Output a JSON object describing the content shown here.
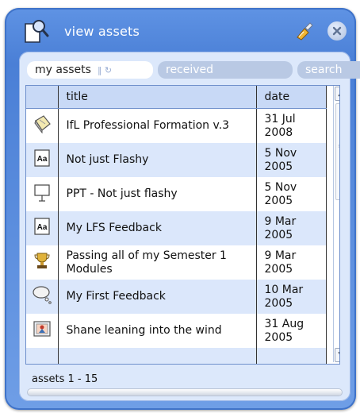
{
  "window": {
    "title": "view assets",
    "icons": {
      "app": "search-document-icon",
      "tool": "brush-icon",
      "close": "close-icon"
    }
  },
  "tabs": [
    {
      "label": "my assets",
      "active": true
    },
    {
      "label": "received",
      "active": false
    },
    {
      "label": "search",
      "active": false
    }
  ],
  "table": {
    "headers": {
      "icon": "",
      "title": "title",
      "date": "date"
    },
    "rows": [
      {
        "icon": "notebook-icon",
        "title": "IfL Professional Formation v.3",
        "date": "31 Jul 2008"
      },
      {
        "icon": "text-document-icon",
        "title": "Not just Flashy",
        "date": "5 Nov 2005"
      },
      {
        "icon": "presentation-icon",
        "title": "PPT - Not just flashy",
        "date": "5 Nov 2005"
      },
      {
        "icon": "text-document-icon",
        "title": "My LFS Feedback",
        "date": "9 Mar 2005"
      },
      {
        "icon": "trophy-icon",
        "title": "Passing all of my Semester 1 Modules",
        "date": "9 Mar 2005"
      },
      {
        "icon": "thought-bubble-icon",
        "title": "My First Feedback",
        "date": "10 Mar 2005"
      },
      {
        "icon": "picture-icon",
        "title": "Shane leaning into the wind",
        "date": "31 Aug 2005"
      },
      {
        "icon": "",
        "title": "",
        "date": ""
      }
    ],
    "doc_icon_text": "Aa"
  },
  "footer": {
    "range": "assets 1 - 15"
  },
  "colors": {
    "frame": "#4a7fd6",
    "panel": "#dce8fb",
    "header": "#c8d9f6",
    "row_alt": "#dbe7fb"
  }
}
